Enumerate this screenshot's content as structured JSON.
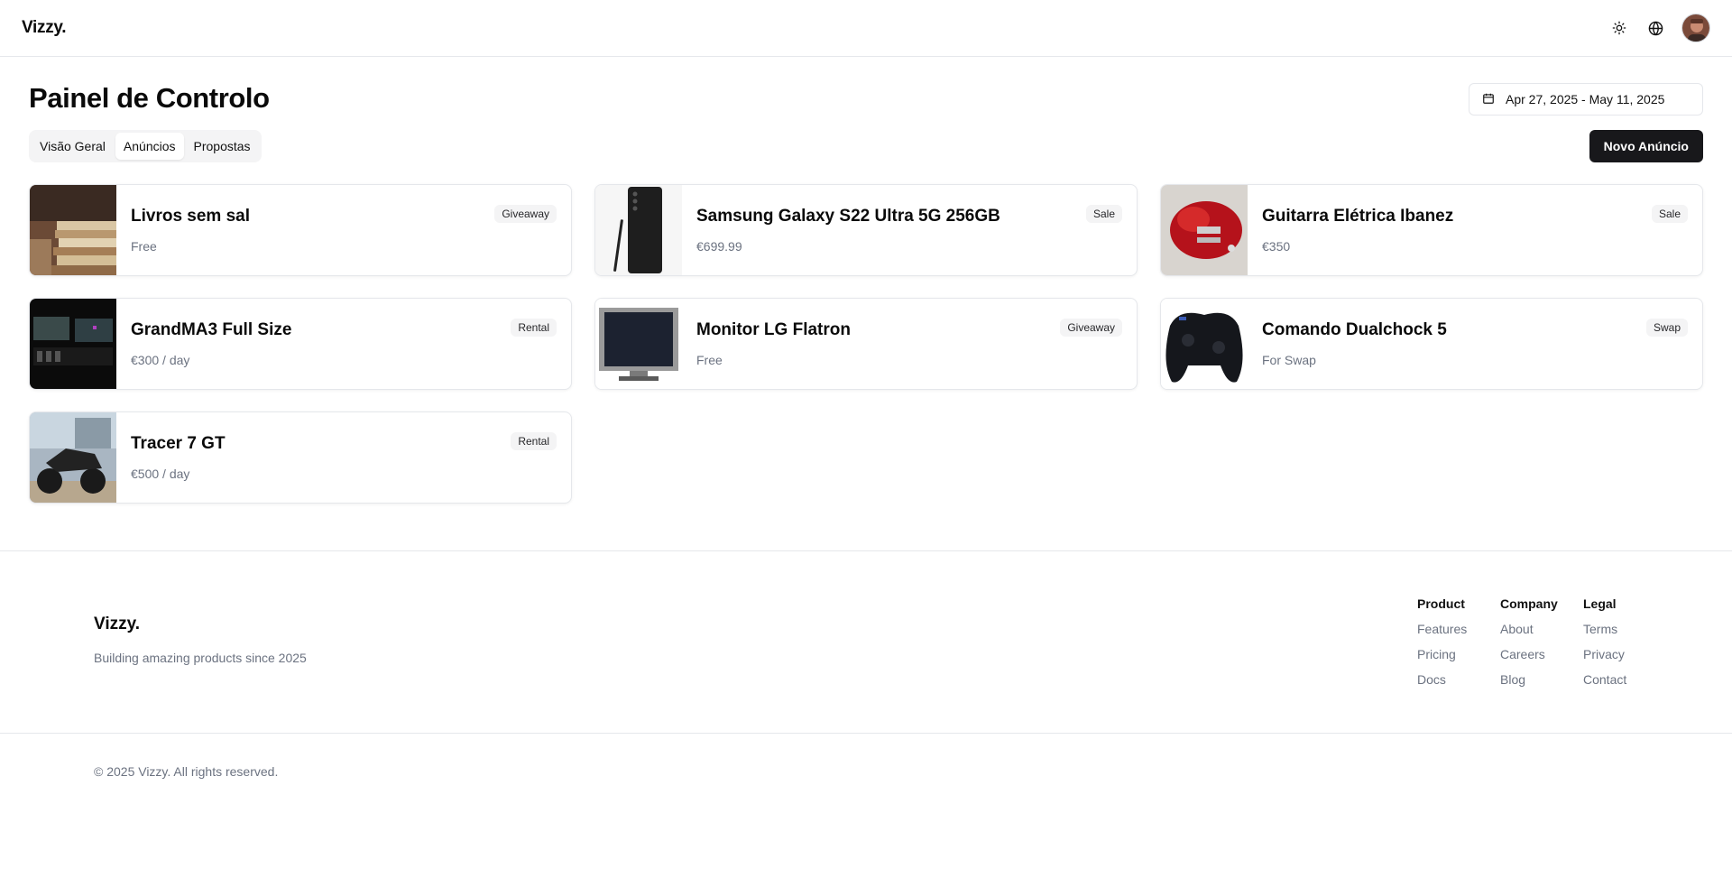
{
  "header": {
    "logo": "Vizzy.",
    "icons": [
      "sun-icon",
      "globe-icon"
    ]
  },
  "main": {
    "title": "Painel de Controlo",
    "date_range": "Apr 27, 2025 - May 11, 2025",
    "tabs": [
      {
        "label": "Visão Geral",
        "active": false
      },
      {
        "label": "Anúncios",
        "active": true
      },
      {
        "label": "Propostas",
        "active": false
      }
    ],
    "new_button": "Novo Anúncio",
    "listings": [
      {
        "title": "Livros sem sal",
        "price": "Free",
        "badge": "Giveaway",
        "image": "books"
      },
      {
        "title": "Samsung Galaxy S22 Ultra 5G 256GB",
        "price": "€699.99",
        "badge": "Sale",
        "image": "phone"
      },
      {
        "title": "Guitarra Elétrica Ibanez",
        "price": "€350",
        "badge": "Sale",
        "image": "guitar"
      },
      {
        "title": "GrandMA3 Full Size",
        "price": "€300 / day",
        "badge": "Rental",
        "image": "console"
      },
      {
        "title": "Monitor LG Flatron",
        "price": "Free",
        "badge": "Giveaway",
        "image": "monitor"
      },
      {
        "title": "Comando Dualchock 5",
        "price": "For Swap",
        "badge": "Swap",
        "image": "controller"
      },
      {
        "title": "Tracer 7 GT",
        "price": "€500 / day",
        "badge": "Rental",
        "image": "motorcycle"
      }
    ]
  },
  "footer": {
    "logo": "Vizzy.",
    "tagline": "Building amazing products since 2025",
    "columns": [
      {
        "heading": "Product",
        "links": [
          "Features",
          "Pricing",
          "Docs"
        ]
      },
      {
        "heading": "Company",
        "links": [
          "About",
          "Careers",
          "Blog"
        ]
      },
      {
        "heading": "Legal",
        "links": [
          "Terms",
          "Privacy",
          "Contact"
        ]
      }
    ],
    "copyright": "© 2025 Vizzy. All rights reserved."
  }
}
